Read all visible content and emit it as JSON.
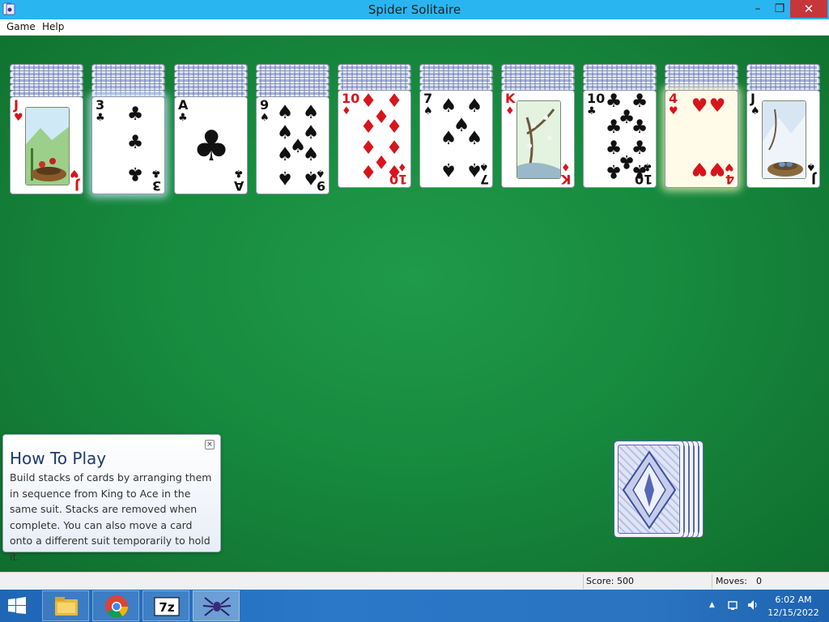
{
  "window": {
    "title": "Spider Solitaire",
    "controls": {
      "minimize": "–",
      "maximize": "❐",
      "close": "✕"
    }
  },
  "menu": {
    "items": [
      "Game",
      "Help"
    ]
  },
  "tableau": [
    {
      "rank": "J",
      "suit": "♥",
      "color": "red",
      "face": "picture"
    },
    {
      "rank": "3",
      "suit": "♣",
      "color": "black",
      "face": "pips"
    },
    {
      "rank": "A",
      "suit": "♣",
      "color": "black",
      "face": "ace"
    },
    {
      "rank": "9",
      "suit": "♠",
      "color": "black",
      "face": "pips"
    },
    {
      "rank": "10",
      "suit": "♦",
      "color": "red",
      "face": "pips"
    },
    {
      "rank": "7",
      "suit": "♠",
      "color": "black",
      "face": "pips"
    },
    {
      "rank": "K",
      "suit": "♦",
      "color": "red",
      "face": "picture"
    },
    {
      "rank": "10",
      "suit": "♣",
      "color": "black",
      "face": "pips"
    },
    {
      "rank": "4",
      "suit": "♥",
      "color": "red",
      "face": "pips"
    },
    {
      "rank": "J",
      "suit": "♠",
      "color": "black",
      "face": "picture"
    }
  ],
  "help_panel": {
    "title": "How To Play",
    "close_label": "×",
    "body": "Build stacks of cards by arranging them in sequence from King to Ace in the same suit. Stacks are removed when complete. You can also move a card onto a different suit temporarily to hold it."
  },
  "status": {
    "score_label": "Score: 500",
    "moves_label": "Moves:",
    "moves_value": "0"
  },
  "taskbar": {
    "apps": [
      "start-icon",
      "file-explorer-icon",
      "chrome-icon",
      "7zip-icon",
      "spider-solitaire-icon"
    ],
    "time": "6:02 AM",
    "date": "12/15/2022"
  },
  "colors": {
    "felt": "#178a3e",
    "titlebar": "#29b6f0",
    "close_button": "#c7363a",
    "red_suit": "#d8141c"
  }
}
